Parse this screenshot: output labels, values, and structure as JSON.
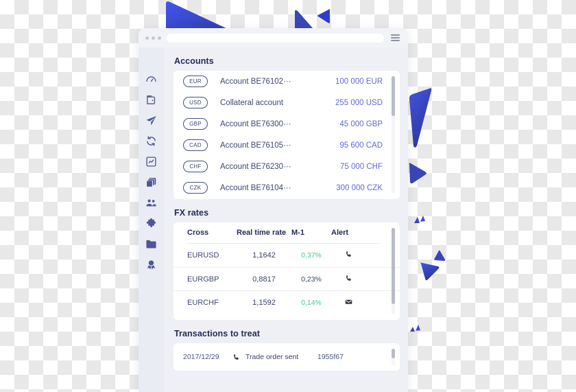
{
  "browser": {
    "url_value": "",
    "url_placeholder": "",
    "menu_icon": "hamburger-icon",
    "dots": [
      "dot",
      "dot",
      "dot"
    ]
  },
  "sidebar": {
    "items": [
      {
        "icon": "dashboard-gauge-icon",
        "name": "dashboard"
      },
      {
        "icon": "wallet-icon",
        "name": "wallet"
      },
      {
        "icon": "send-paper-plane-icon",
        "name": "payments"
      },
      {
        "icon": "refresh-sync-icon",
        "name": "transfers"
      },
      {
        "icon": "chart-analytics-icon",
        "name": "analytics"
      },
      {
        "icon": "layers-copy-icon",
        "name": "documents"
      },
      {
        "icon": "users-group-icon",
        "name": "users"
      },
      {
        "icon": "puzzle-piece-icon",
        "name": "integrations"
      },
      {
        "icon": "folder-icon",
        "name": "files"
      },
      {
        "icon": "award-badge-icon",
        "name": "certificates"
      }
    ]
  },
  "accounts": {
    "title": "Accounts",
    "rows": [
      {
        "currency": "EUR",
        "name": "Account BE76102",
        "ellipsis": "···",
        "amount": "100 000 EUR"
      },
      {
        "currency": "USD",
        "name": "Collateral account",
        "ellipsis": "",
        "amount": "255 000 USD"
      },
      {
        "currency": "GBP",
        "name": "Account BE76300",
        "ellipsis": "···",
        "amount": "45 000 GBP"
      },
      {
        "currency": "CAD",
        "name": "Account BE76105",
        "ellipsis": "···",
        "amount": "95 600 CAD"
      },
      {
        "currency": "CHF",
        "name": "Account BE76230",
        "ellipsis": "···",
        "amount": "75 000 CHF"
      },
      {
        "currency": "CZK",
        "name": "Account BE76104",
        "ellipsis": "···",
        "amount": "300 000 CZK"
      }
    ]
  },
  "fx": {
    "title": "FX rates",
    "columns": {
      "cross": "Cross",
      "rate": "Real time rate",
      "m1": "M-1",
      "alert": "Alert"
    },
    "rows": [
      {
        "cross": "EURUSD",
        "rate": "1,1642",
        "m1": "0,37%",
        "m1_positive": true,
        "alert_icon": "phone-icon"
      },
      {
        "cross": "EURGBP",
        "rate": "0,8817",
        "m1": "0,23%",
        "m1_positive": false,
        "alert_icon": "phone-icon"
      },
      {
        "cross": "EURCHF",
        "rate": "1,1592",
        "m1": "0,14%",
        "m1_positive": true,
        "alert_icon": "email-icon"
      }
    ]
  },
  "transactions": {
    "title": "Transactions to treat",
    "rows": [
      {
        "date": "2017/12/29",
        "icon": "phone-icon",
        "label": "Trade order sent",
        "reference": "1955f67"
      }
    ]
  },
  "colors": {
    "accent_blue": "#6068d6",
    "navy": "#242c55",
    "positive_green": "#49c98a",
    "deco_blue": "#3b4bd8",
    "deco_blue_dark": "#2f3aa8",
    "sidebar_bg": "#eaecf3",
    "panel_bg": "#ffffff",
    "window_bg": "#eef0f6"
  }
}
